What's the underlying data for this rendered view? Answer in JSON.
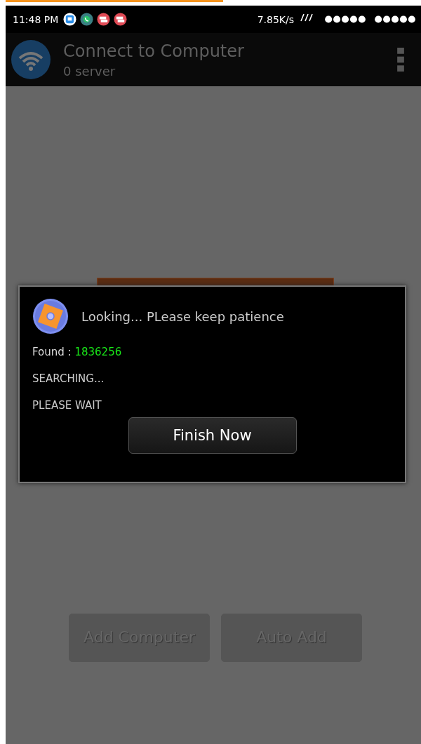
{
  "page_loading_bar": {
    "level": 0.53
  },
  "status_bar": {
    "time": "11:48 PM",
    "speed": "7.85K/s",
    "notifications": [
      {
        "kind": "hi"
      },
      {
        "kind": "phone"
      },
      {
        "kind": "message"
      },
      {
        "kind": "message"
      }
    ]
  },
  "app_bar": {
    "title": "Connect to Computer",
    "subtitle": "0 server"
  },
  "dialog": {
    "message": "Looking... PLease keep patience",
    "found_label": "Found :",
    "found_value": "1836256",
    "lines": [
      "SEARCHING...",
      "PLEASE WAIT"
    ],
    "button": "Finish Now"
  },
  "buttons": [
    {
      "label": "Add Computer",
      "disabled": true
    },
    {
      "label": "Auto Add",
      "disabled": true
    }
  ]
}
